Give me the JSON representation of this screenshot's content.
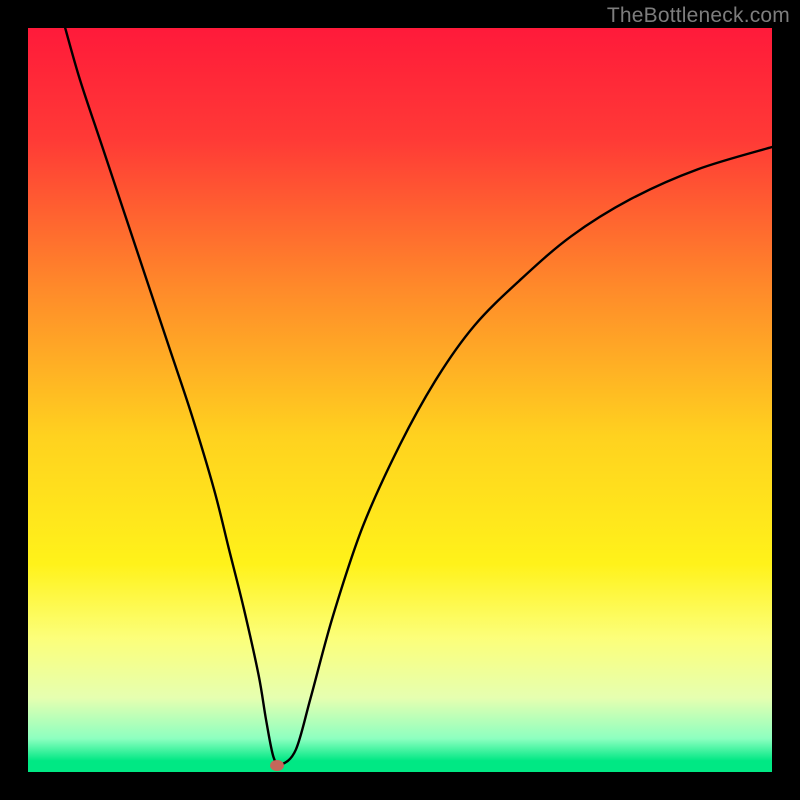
{
  "watermark": "TheBottleneck.com",
  "chart_data": {
    "type": "line",
    "title": "",
    "xlabel": "",
    "ylabel": "",
    "xlim": [
      0,
      100
    ],
    "ylim": [
      0,
      100
    ],
    "gradient_stops": [
      {
        "pos": 0.0,
        "color": "#ff1a3a"
      },
      {
        "pos": 0.15,
        "color": "#ff3a36"
      },
      {
        "pos": 0.35,
        "color": "#ff8a2a"
      },
      {
        "pos": 0.55,
        "color": "#ffd21f"
      },
      {
        "pos": 0.72,
        "color": "#fff21a"
      },
      {
        "pos": 0.82,
        "color": "#fcff7a"
      },
      {
        "pos": 0.9,
        "color": "#e6ffb0"
      },
      {
        "pos": 0.955,
        "color": "#8dffc0"
      },
      {
        "pos": 0.985,
        "color": "#00e884"
      },
      {
        "pos": 1.0,
        "color": "#00e884"
      }
    ],
    "series": [
      {
        "name": "bottleneck-curve",
        "x": [
          5,
          7,
          10,
          13,
          16,
          19,
          22,
          25,
          27,
          29,
          31,
          32,
          33,
          34,
          36,
          38,
          41,
          45,
          50,
          55,
          60,
          66,
          73,
          81,
          90,
          100
        ],
        "y": [
          100,
          93,
          84,
          75,
          66,
          57,
          48,
          38,
          30,
          22,
          13,
          7,
          2,
          1,
          3,
          10,
          21,
          33,
          44,
          53,
          60,
          66,
          72,
          77,
          81,
          84
        ]
      }
    ],
    "optimal_point": {
      "x": 33.5,
      "y": 1
    },
    "annotations": []
  }
}
